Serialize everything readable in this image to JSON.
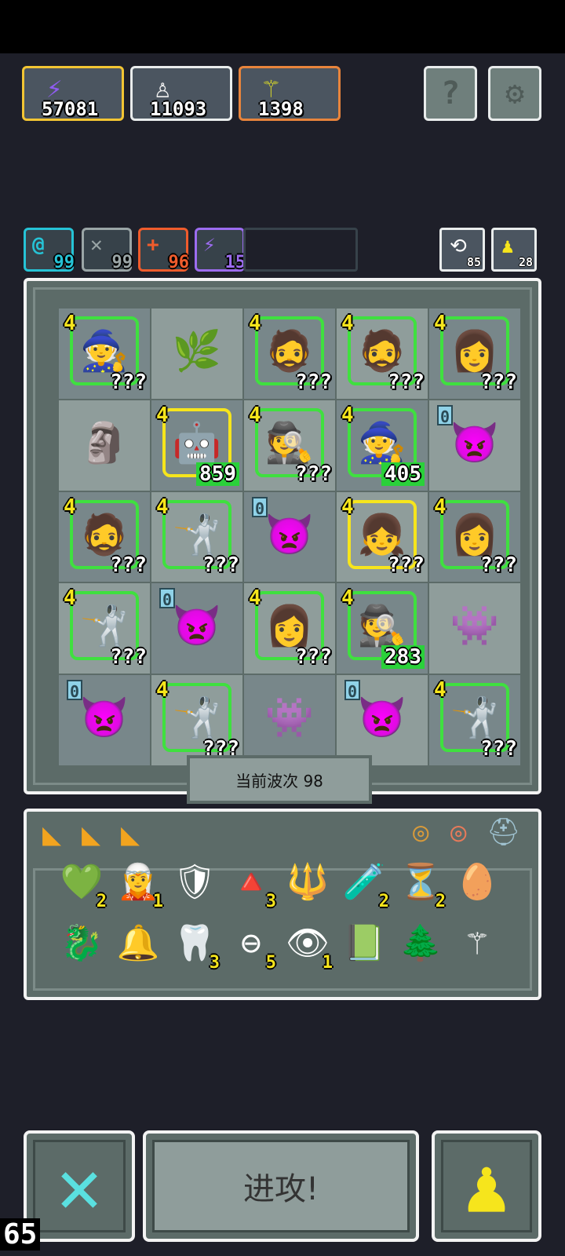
{
  "currencies": [
    {
      "icon": "⚡",
      "value": "57081",
      "border": "#f3c533"
    },
    {
      "icon": "♙",
      "value": "11093",
      "border": "#e9ecec"
    },
    {
      "icon": "⚚",
      "value": "1398",
      "border": "#e8843c"
    }
  ],
  "top_buttons": {
    "help": "?",
    "settings": "⚙"
  },
  "stats": [
    {
      "icon": "@",
      "value": "99",
      "color": "#26c3d6"
    },
    {
      "icon": "✕",
      "value": "99",
      "color": "#9aa5a6"
    },
    {
      "icon": "+",
      "value": "96",
      "color": "#f05c2c"
    },
    {
      "icon": "⚡",
      "value": "15",
      "color": "#9c6cf0"
    }
  ],
  "right_stats": [
    {
      "icon": "⟲",
      "value": "85"
    },
    {
      "icon": "♟",
      "value": "28"
    }
  ],
  "grid": [
    [
      {
        "face": "🧙",
        "stars": "4",
        "dmg": "???",
        "border": "#3fe03f"
      },
      {
        "face": "🌿",
        "stars": "",
        "dmg": "",
        "border": "transparent"
      },
      {
        "face": "🧔",
        "stars": "4",
        "dmg": "???",
        "border": "#3fe03f"
      },
      {
        "face": "🧔",
        "stars": "4",
        "dmg": "???",
        "border": "#3fe03f"
      },
      {
        "face": "👩",
        "stars": "4",
        "dmg": "???",
        "border": "#3fe03f"
      }
    ],
    [
      {
        "face": "🗿",
        "stars": "",
        "dmg": "",
        "border": "transparent"
      },
      {
        "face": "🤖",
        "stars": "4",
        "dmg": "859",
        "border": "#f6e51c",
        "green": true
      },
      {
        "face": "🕵",
        "stars": "4",
        "dmg": "???",
        "border": "#3fe03f"
      },
      {
        "face": "🧙",
        "stars": "4",
        "dmg": "405",
        "border": "#3fe03f",
        "green": true
      },
      {
        "face": "👿",
        "stars": "0",
        "dmg": "",
        "border": "transparent"
      }
    ],
    [
      {
        "face": "🧔",
        "stars": "4",
        "dmg": "???",
        "border": "#3fe03f"
      },
      {
        "face": "🤺",
        "stars": "4",
        "dmg": "???",
        "border": "#3fe03f"
      },
      {
        "face": "👿",
        "stars": "0",
        "dmg": "",
        "border": "transparent"
      },
      {
        "face": "👧",
        "stars": "4",
        "dmg": "???",
        "border": "#f6e51c"
      },
      {
        "face": "👩",
        "stars": "4",
        "dmg": "???",
        "border": "#3fe03f"
      }
    ],
    [
      {
        "face": "🤺",
        "stars": "4",
        "dmg": "???",
        "border": "#3fe03f"
      },
      {
        "face": "👿",
        "stars": "0",
        "dmg": "",
        "border": "transparent"
      },
      {
        "face": "👩",
        "stars": "4",
        "dmg": "???",
        "border": "#3fe03f"
      },
      {
        "face": "🕵",
        "stars": "4",
        "dmg": "283",
        "border": "#3fe03f",
        "green": true
      },
      {
        "face": "👾",
        "stars": "",
        "dmg": "",
        "border": "transparent"
      }
    ],
    [
      {
        "face": "👿",
        "stars": "0",
        "dmg": "",
        "border": "transparent"
      },
      {
        "face": "🤺",
        "stars": "4",
        "dmg": "???",
        "border": "#3fe03f"
      },
      {
        "face": "👾",
        "stars": "",
        "dmg": "",
        "border": "transparent"
      },
      {
        "face": "👿",
        "stars": "0",
        "dmg": "",
        "border": "transparent"
      },
      {
        "face": "🤺",
        "stars": "4",
        "dmg": "???",
        "border": "#3fe03f"
      }
    ]
  ],
  "wave_label": "当前波次 98",
  "item_tabs": [
    "◣",
    "◣",
    "◣"
  ],
  "rings": [
    "◎",
    "◎",
    "⛑"
  ],
  "items_row1": [
    {
      "icon": "💚",
      "count": "2",
      "name": "gem"
    },
    {
      "icon": "🧝",
      "count": "1",
      "name": "figure"
    },
    {
      "icon": "🛡",
      "count": "",
      "name": "shield"
    },
    {
      "icon": "🔺",
      "count": "3",
      "name": "crystal"
    },
    {
      "icon": "🔱",
      "count": "",
      "name": "crown"
    },
    {
      "icon": "🧪",
      "count": "2",
      "name": "potion"
    },
    {
      "icon": "⏳",
      "count": "2",
      "name": "hourglass"
    },
    {
      "icon": "🥚",
      "count": "",
      "name": "egg"
    }
  ],
  "items_row2": [
    {
      "icon": "🐉",
      "count": "",
      "name": "dragon"
    },
    {
      "icon": "🔔",
      "count": "",
      "name": "bell"
    },
    {
      "icon": "🦷",
      "count": "3",
      "name": "tooth"
    },
    {
      "icon": "⊖",
      "count": "5",
      "name": "orbit"
    },
    {
      "icon": "👁",
      "count": "1",
      "name": "eye"
    },
    {
      "icon": "📗",
      "count": "",
      "name": "book"
    },
    {
      "icon": "🌲",
      "count": "",
      "name": "plant"
    },
    {
      "icon": "⚚",
      "count": "",
      "name": "staff"
    }
  ],
  "bottom": {
    "attack": "进攻!",
    "cancel_icon": "✕",
    "pawn_icon": "♟"
  },
  "fps": "65"
}
